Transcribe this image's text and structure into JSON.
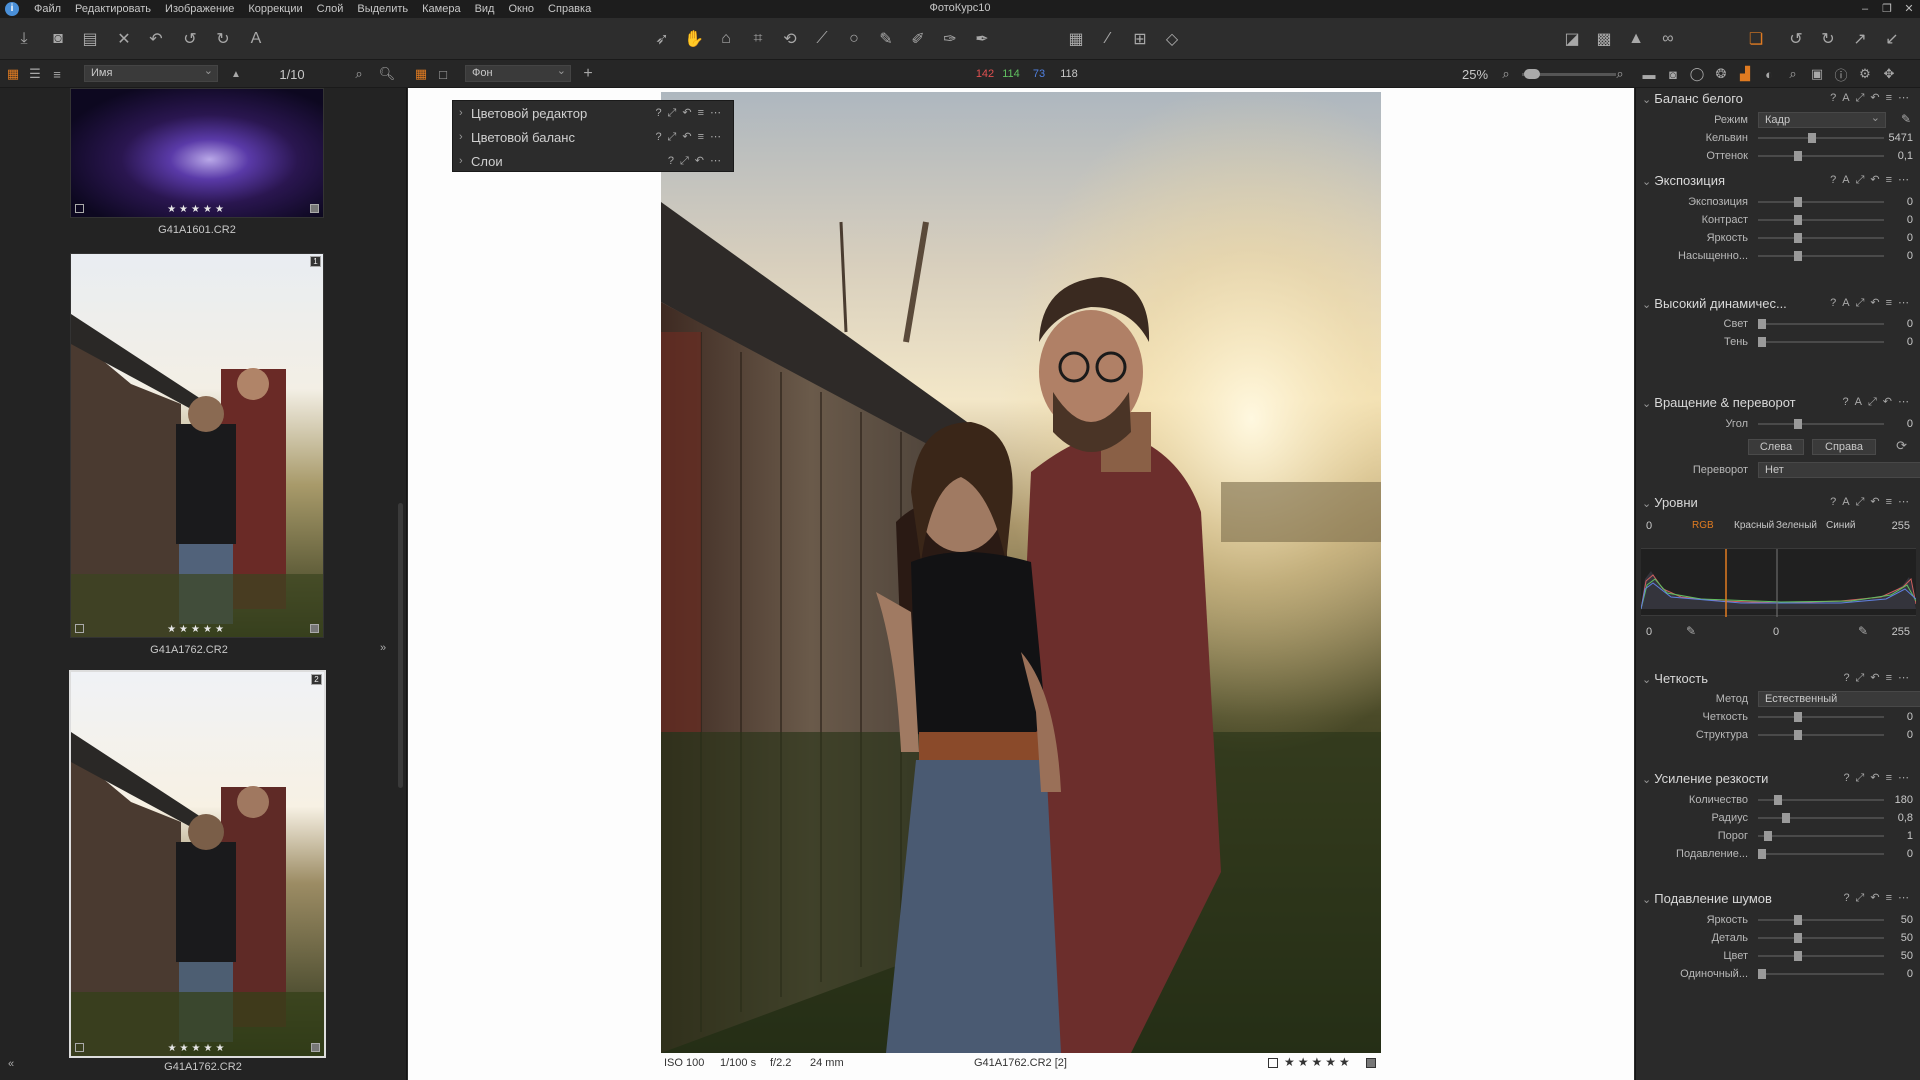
{
  "menu": {
    "items": [
      "Файл",
      "Редактировать",
      "Изображение",
      "Коррекции",
      "Слой",
      "Выделить",
      "Камера",
      "Вид",
      "Окно",
      "Справка"
    ],
    "app_title": "ФотоКурс10"
  },
  "browser": {
    "sort_label": "Имя",
    "counter": "1/10",
    "thumbs": [
      {
        "name": "G41A1601.CR2",
        "stars": "★★★★★"
      },
      {
        "name": "G41A1762.CR2",
        "stars": "★★★★★",
        "badge": "1"
      },
      {
        "name": "G41A1762.CR2",
        "stars": "★★★★★",
        "badge": "2"
      }
    ]
  },
  "viewer": {
    "layer_select": "Фон",
    "readout": {
      "r": "142",
      "g": "114",
      "b": "73",
      "l": "118"
    },
    "zoom": "25%",
    "tool_panels": [
      "Цветовой редактор",
      "Цветовой баланс",
      "Слои"
    ],
    "info": {
      "iso": "ISO 100",
      "shutter": "1/100 s",
      "aperture": "f/2.2",
      "focal": "24 mm",
      "file": "G41A1762.CR2 [2]",
      "stars": "★★★★★"
    }
  },
  "panel": {
    "wb": {
      "title": "Баланс белого",
      "mode_label": "Режим",
      "mode": "Кадр",
      "kelvin_label": "Кельвин",
      "kelvin": "5471",
      "tint_label": "Оттенок",
      "tint": "0,1"
    },
    "exposure": {
      "title": "Экспозиция",
      "rows": [
        {
          "label": "Экспозиция",
          "value": "0"
        },
        {
          "label": "Контраст",
          "value": "0"
        },
        {
          "label": "Яркость",
          "value": "0"
        },
        {
          "label": "Насыщенно...",
          "value": "0"
        }
      ]
    },
    "hdr": {
      "title": "Высокий динамичес...",
      "rows": [
        {
          "label": "Свет",
          "value": "0"
        },
        {
          "label": "Тень",
          "value": "0"
        }
      ]
    },
    "rotation": {
      "title": "Вращение & переворот",
      "angle_label": "Угол",
      "angle": "0",
      "left_btn": "Слева",
      "right_btn": "Справа",
      "flip_label": "Переворот",
      "flip": "Нет"
    },
    "levels": {
      "title": "Уровни",
      "tabs": [
        "RGB",
        "Красный",
        "Зеленый",
        "Синий"
      ],
      "in_low": "0",
      "in_high": "255",
      "out_low": "0",
      "out_mid": "0",
      "out_high": "255"
    },
    "clarity": {
      "title": "Четкость",
      "method_label": "Метод",
      "method": "Естественный",
      "rows": [
        {
          "label": "Четкость",
          "value": "0"
        },
        {
          "label": "Структура",
          "value": "0"
        }
      ]
    },
    "sharpen": {
      "title": "Усиление резкости",
      "rows": [
        {
          "label": "Количество",
          "value": "180"
        },
        {
          "label": "Радиус",
          "value": "0,8"
        },
        {
          "label": "Порог",
          "value": "1"
        },
        {
          "label": "Подавление...",
          "value": "0"
        }
      ]
    },
    "noise": {
      "title": "Подавление шумов",
      "rows": [
        {
          "label": "Яркость",
          "value": "50"
        },
        {
          "label": "Деталь",
          "value": "50"
        },
        {
          "label": "Цвет",
          "value": "50"
        },
        {
          "label": "Одиночный...",
          "value": "0"
        }
      ]
    }
  }
}
